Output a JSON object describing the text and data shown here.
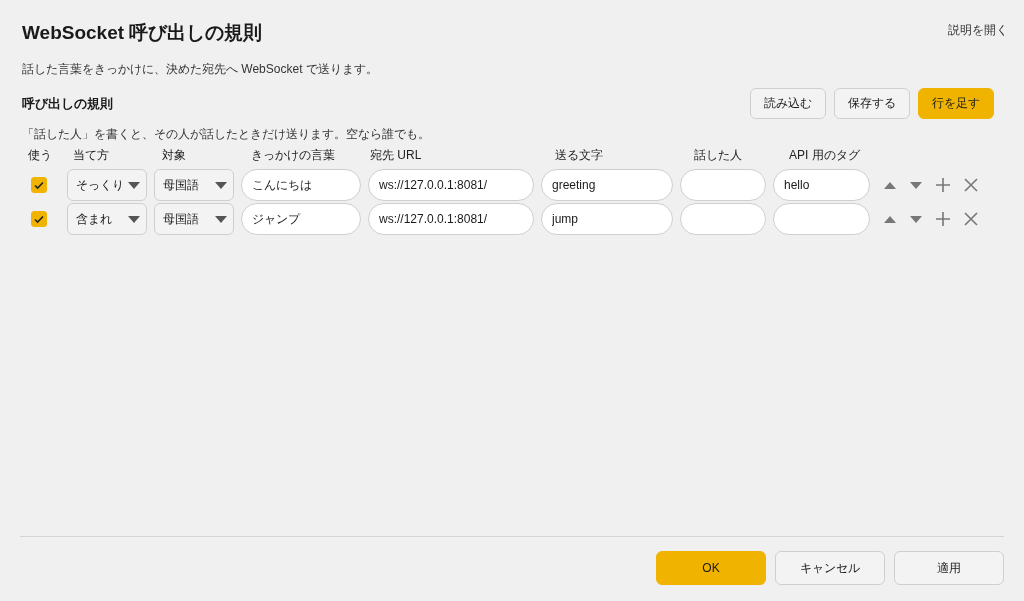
{
  "window": {
    "title": "WebSocket 呼び出しの規則",
    "help_link": "説明を開く"
  },
  "description": "話した言葉をきっかけに、決めた宛先へ WebSocket で送ります。",
  "section": {
    "title": "呼び出しの規則",
    "hint": "「話した人」を書くと、その人が話したときだけ送ります。空なら誰でも。",
    "buttons": [
      {
        "label": "読み込む",
        "kind": "default"
      },
      {
        "label": "保存する",
        "kind": "default"
      },
      {
        "label": "行を足す",
        "kind": "primary"
      }
    ]
  },
  "table": {
    "columns": [
      "使う",
      "当て方",
      "対象",
      "きっかけの言葉",
      "宛先 URL",
      "送る文字",
      "話した人",
      "API 用のタグ"
    ],
    "rows": [
      {
        "checked": true,
        "match": "そっくり",
        "target": "母国語",
        "trigger": "こんにちは",
        "url": "ws://127.0.0.1:8081/",
        "send": "greeting",
        "tag": "hello"
      },
      {
        "checked": true,
        "match": "含まれ",
        "target": "母国語",
        "trigger": "ジャンプ",
        "url": "ws://127.0.0.1:8081/",
        "send": "jump"
      }
    ]
  },
  "footer": {
    "buttons": [
      {
        "label": "OK",
        "kind": "primary"
      },
      {
        "label": "キャンセル",
        "kind": "default"
      },
      {
        "label": "適用",
        "kind": "default"
      }
    ]
  }
}
